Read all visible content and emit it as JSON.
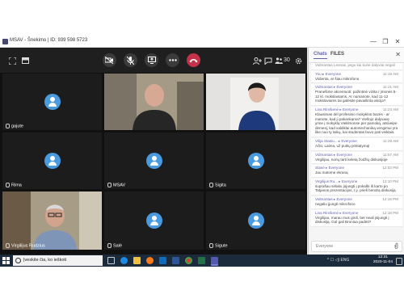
{
  "window": {
    "title": "MSAV - Šnekimo | ID: 939 598 5723",
    "controls": [
      "—",
      "❐",
      "✕"
    ]
  },
  "toolbar": {
    "fullscreen_icon": "fullscreen-icon",
    "layout_icon": "layout-icon",
    "camera_off_icon": "camera-off-icon",
    "mic_off_icon": "mic-off-icon",
    "share_icon": "share-screen-icon",
    "more_icon": "more-icon",
    "hangup_icon": "hangup-icon",
    "add_person_icon": "add-person-icon",
    "chat_icon": "chat-icon",
    "participants_count": "30",
    "settings_icon": "settings-icon"
  },
  "tiles": [
    {
      "label": "gajute",
      "type": "avatar"
    },
    {
      "label": "",
      "type": "video"
    },
    {
      "label": "",
      "type": "video"
    },
    {
      "label": "Rima",
      "type": "avatar"
    },
    {
      "label": "MSAV",
      "type": "avatar"
    },
    {
      "label": "Sigita",
      "type": "avatar"
    },
    {
      "label": "Virgilijus Rudzius",
      "type": "video"
    },
    {
      "label": "Salė",
      "type": "avatar"
    },
    {
      "label": "Sigute",
      "type": "avatar"
    }
  ],
  "chat": {
    "tabs": [
      "Chats",
      "FILES"
    ],
    "close_label": "✕",
    "top_text": "Vidmantas Leonas, jeigu kai kurie dalyviai negali",
    "messages": [
      {
        "from": "You",
        "to": "Everyone",
        "time": "11:18 AM",
        "text": "Vidienta, ar šiau mikrofono"
      },
      {
        "from": "Vidmantas",
        "to": "Everyone",
        "time": "11:21 AM",
        "text": "Pranešime akcentuoti: pažintinė vizita / įmonės 5-12 kl. mokslavtams. Ar numanote, kad 11-12 mokslaviams tai galėsite pavaišinta akcija?"
      },
      {
        "from": "Lina Rimšienė",
        "to": "Everyone",
        "time": "11:24 AM",
        "text": "Klausimas dėl profesinio mokyklos bazės - ar manote, kad ji pakankama? Viešojo dalyvavę yrine į mokyklą Vieklmonse per pamoką, atsiveipe dėmesį, kad valdiklai automechaniką vengimui yra like nuo ty laikų, kai studentas buvo pati veiklais."
      },
      {
        "from": "Vilija Stasiu...",
        "to": "Everyone",
        "time": "11:29 AM",
        "text": "Ačiū, Laima, už puikų pristatymą!"
      },
      {
        "from": "Vidmantas",
        "to": "Everyone",
        "time": "11:57 AM",
        "text": "Virgilijau, norių tarti keletą žodžių diskusijoje"
      },
      {
        "from": "Stasė",
        "to": "Everyone",
        "time": "12:03 PM",
        "text": "Jau matome ekraną"
      },
      {
        "from": "Virgilijus Ru...",
        "to": "Everyone",
        "time": "12:10 PM",
        "text": "suprašau sėlaku jojungti į pokalbi iš karto po Tatjanos prezentacijos, t.y. prieš bendrą diskusiją"
      },
      {
        "from": "Vidmantas",
        "to": "Everyone",
        "time": "12:16 PM",
        "text": "negaliu įjungti mikrofono"
      },
      {
        "from": "Lina Rimšienė",
        "to": "Everyone",
        "time": "12:18 PM",
        "text": "Virgilijau, marau mus girdi, bet neali įsijungti į diskusiją. Gal gali Broniua padėti?"
      }
    ],
    "input_placeholder": "Everyone",
    "attach_icon": "paperclip-icon"
  },
  "taskbar": {
    "search_placeholder": "Įveskite čia, ko ieškoti",
    "time": "12:31",
    "date": "2020-11-04",
    "tray_text": "^ ☐ ◁) ENG",
    "apps": [
      "task-view-icon",
      "edge-icon",
      "store-icon",
      "firefox-icon",
      "mail-icon",
      "word-icon",
      "chrome-icon",
      "excel-icon",
      "teams-icon"
    ]
  }
}
